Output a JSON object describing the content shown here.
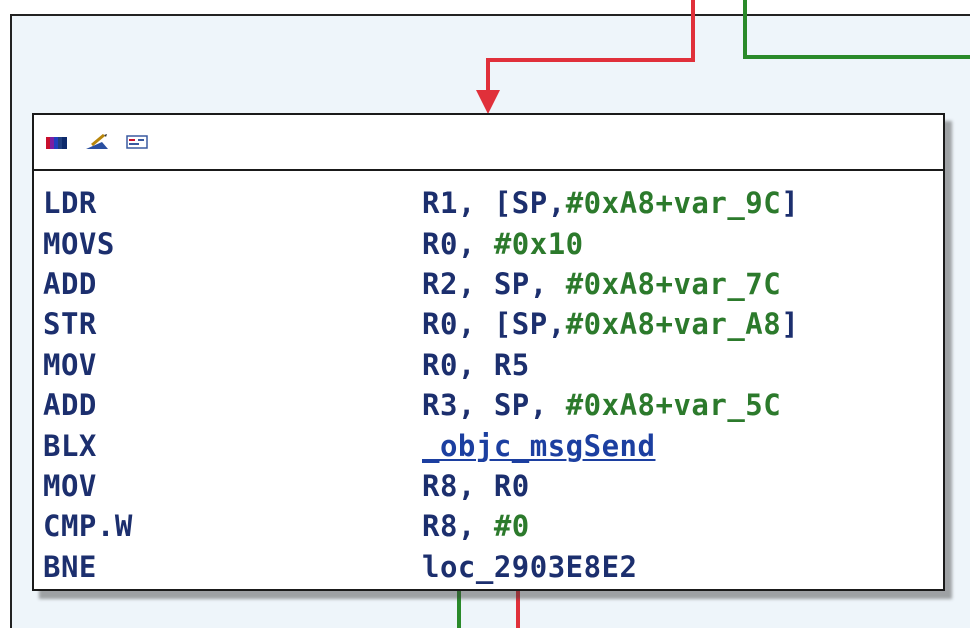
{
  "toolbar": {
    "icons": [
      "graph-colors-icon",
      "edit-node-icon",
      "node-text-icon"
    ]
  },
  "colors": {
    "true_branch": "#2a8a2a",
    "false_branch": "#e0303a",
    "canvas": "#eef5fa",
    "mnemonic": "#1c2f6e",
    "immediate": "#2c7a2c"
  },
  "instructions": [
    {
      "mnemonic": "LDR",
      "op_a": "R1, [SP,",
      "op_b": "#0xA8+var_9C",
      "op_c": "]"
    },
    {
      "mnemonic": "MOVS",
      "op_a": "R0, ",
      "op_b": "#0x10",
      "op_c": ""
    },
    {
      "mnemonic": "ADD",
      "op_a": "R2, SP, ",
      "op_b": "#0xA8+var_7C",
      "op_c": ""
    },
    {
      "mnemonic": "STR",
      "op_a": "R0, [SP,",
      "op_b": "#0xA8+var_A8",
      "op_c": "]"
    },
    {
      "mnemonic": "MOV",
      "op_a": "R0, R5",
      "op_b": "",
      "op_c": ""
    },
    {
      "mnemonic": "ADD",
      "op_a": "R3, SP, ",
      "op_b": "#0xA8+var_5C",
      "op_c": ""
    },
    {
      "mnemonic": "BLX",
      "op_a": "",
      "op_b": "",
      "op_c": "",
      "sym": "_objc_msgSend"
    },
    {
      "mnemonic": "MOV",
      "op_a": "R8, R0",
      "op_b": "",
      "op_c": ""
    },
    {
      "mnemonic": "CMP.W",
      "op_a": "R8, ",
      "op_b": "#0",
      "op_c": ""
    },
    {
      "mnemonic": "BNE",
      "op_a": "loc_2903E8E2",
      "op_b": "",
      "op_c": ""
    }
  ]
}
